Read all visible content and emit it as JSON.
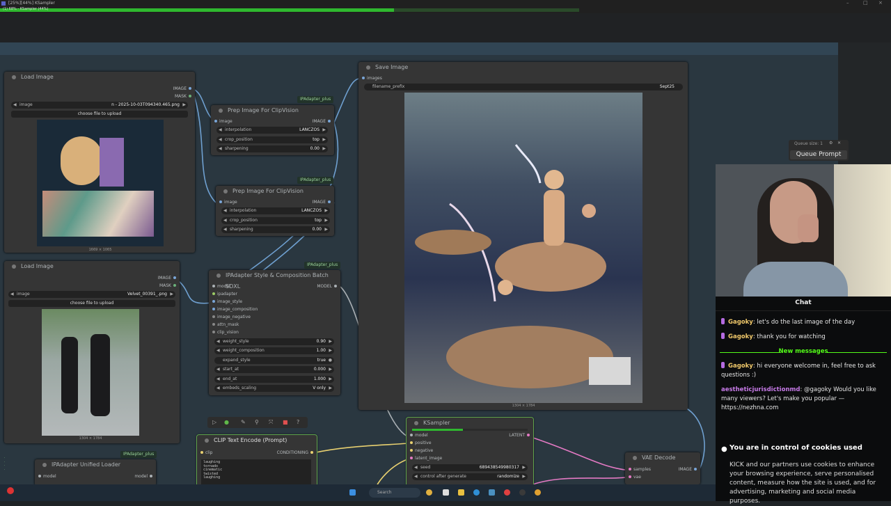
{
  "window": {
    "title": "[25%][44%] KSampler",
    "progress_label": "(1) 68% - KSampler (44%)",
    "progress_pct": 68
  },
  "nodes": {
    "load_image_1": {
      "title": "Load Image",
      "out_image": "IMAGE",
      "out_mask": "MASK",
      "image_label": "image",
      "image_value": "n - 2025-10-03T094340.465.png",
      "upload": "choose file to upload",
      "size": "1669 × 1065"
    },
    "load_image_2": {
      "title": "Load Image",
      "out_image": "IMAGE",
      "out_mask": "MASK",
      "image_label": "image",
      "image_value": "Velvet_00391_.png",
      "upload": "choose file to upload",
      "size": "1304 × 1784"
    },
    "prep1": {
      "title": "Prep Image For ClipVision",
      "tag": "IPAdapter_plus",
      "in_image": "image",
      "out_image": "IMAGE",
      "interp_label": "interpolation",
      "interp_value": "LANCZOS",
      "crop_label": "crop_position",
      "crop_value": "top",
      "sharp_label": "sharpening",
      "sharp_value": "0.00"
    },
    "prep2": {
      "title": "Prep Image For ClipVision",
      "tag": "IPAdapter_plus",
      "in_image": "image",
      "out_image": "IMAGE",
      "interp_label": "interpolation",
      "interp_value": "LANCZOS",
      "crop_label": "crop_position",
      "crop_value": "top",
      "sharp_label": "sharpening",
      "sharp_value": "0.00"
    },
    "ipadapter": {
      "title": "IPAdapter Style & Composition Batch SDXL",
      "tag": "IPAdapter_plus",
      "out_model": "MODEL",
      "inputs": [
        "model",
        "ipadapter",
        "image_style",
        "image_composition",
        "image_negative",
        "attn_mask",
        "clip_vision"
      ],
      "w_style_label": "weight_style",
      "w_style": "0.90",
      "w_comp_label": "weight_composition",
      "w_comp": "1.00",
      "expand_label": "expand_style",
      "expand": "true",
      "start_label": "start_at",
      "start": "0.000",
      "end_label": "end_at",
      "end": "1.000",
      "embeds_label": "embeds_scaling",
      "embeds": "V only"
    },
    "save": {
      "title": "Save Image",
      "in_images": "images",
      "prefix_label": "filename_prefix",
      "prefix_value": "Sept25",
      "size": "1304 × 1784"
    },
    "ksampler": {
      "title": "KSampler",
      "out_latent": "LATENT",
      "inputs": [
        "model",
        "positive",
        "negative",
        "latent_image"
      ],
      "seed_label": "seed",
      "seed": "689438549980317",
      "cag_label": "control after generate",
      "cag": "randomize",
      "progress_pct": 44
    },
    "clip": {
      "title": "CLIP Text Encode (Prompt)",
      "in_clip": "clip",
      "out_cond": "CONDITIONING",
      "text": [
        "laughing",
        "tornado",
        "cinematic",
        "twisted",
        "laughing"
      ]
    },
    "vae": {
      "title": "VAE Decode",
      "in_samples": "samples",
      "in_vae": "vae",
      "out_image": "IMAGE"
    },
    "unified": {
      "title": "IPAdapter Unified Loader",
      "tag": "IPAdapter_plus",
      "in_model": "model",
      "out_model": "model"
    }
  },
  "queue": {
    "size_label": "Queue size: 1",
    "button": "Queue Prompt"
  },
  "chat": {
    "title": "Chat",
    "messages": [
      {
        "user": "Gagoky",
        "text": "let's do the last image of the day"
      },
      {
        "user": "Gagoky",
        "text": "thank you for watching"
      }
    ],
    "new_label": "New messages",
    "messages_new": [
      {
        "user": "Gagoky",
        "text": "hi everyone welcome in, feel free to ask questions :)"
      },
      {
        "user": "aestheticjurisdictionmd",
        "text": "@gagoky Would you like many viewers? Let's make you popular — https://nezhna.com"
      }
    ]
  },
  "cookie": {
    "title": "You are in control of cookies used",
    "body": "KICK and our partners use cookies to enhance your browsing experience, serve personalised content, measure how the site is used, and for advertising, marketing and social media purposes."
  },
  "taskbar": {
    "search": "Search"
  },
  "colors": {
    "accent": "#53fc18",
    "node_bg": "#353535",
    "canvas": "#2a3740",
    "kick_green": "#53fc18"
  }
}
